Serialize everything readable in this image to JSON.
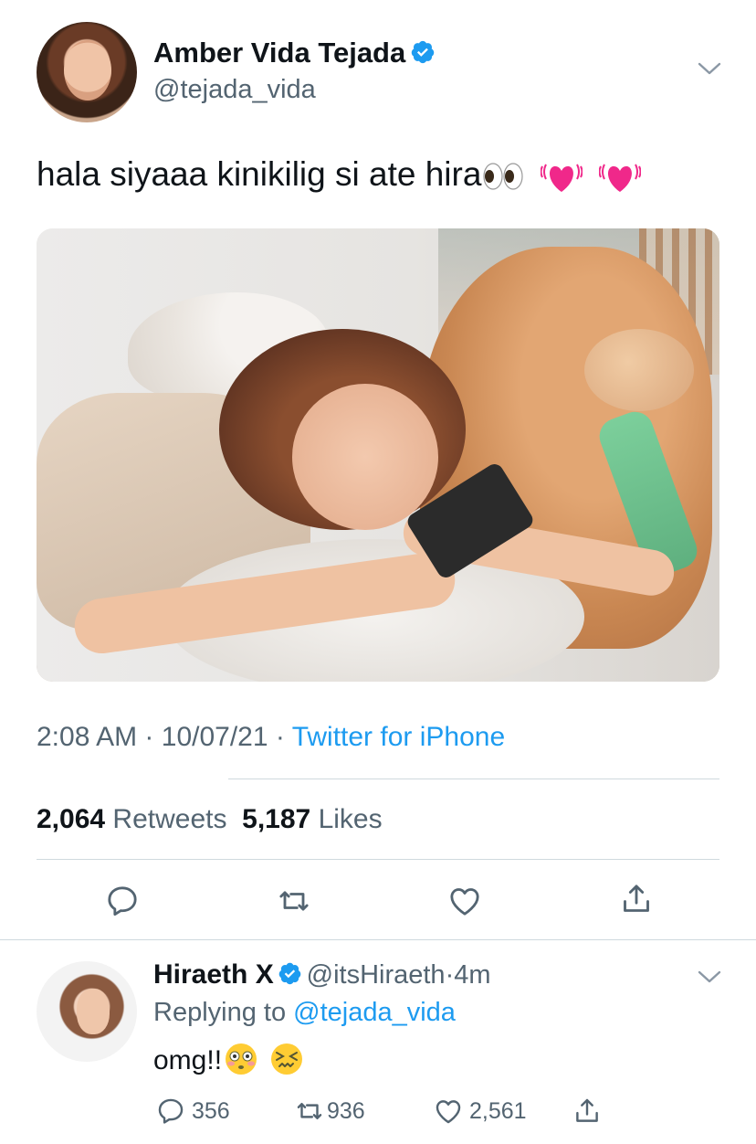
{
  "tweet": {
    "author": {
      "display_name": "Amber Vida Tejada",
      "handle": "@tejada_vida",
      "verified": true
    },
    "text": "hala siyaaa kinikilig si ate hira",
    "text_emojis": [
      "eyes",
      "growing-heart",
      "growing-heart"
    ],
    "time": "2:08 AM",
    "date": "10/07/21",
    "source": "Twitter for iPhone",
    "separator": "·",
    "stats": {
      "retweets_count": "2,064",
      "retweets_label": "Retweets",
      "likes_count": "5,187",
      "likes_label": "Likes"
    },
    "actions": [
      "reply-icon",
      "retweet-icon",
      "like-icon",
      "share-icon"
    ]
  },
  "reply": {
    "author": {
      "display_name": "Hiraeth X",
      "handle": "@itsHiraeth",
      "verified": true
    },
    "time_ago": "4m",
    "separator": "·",
    "replying_to_label": "Replying to",
    "replying_to_handle": "@tejada_vida",
    "text": "omg!!",
    "text_emojis": [
      "flushed-face",
      "confounded-face"
    ],
    "counts": {
      "replies": "356",
      "retweets": "936",
      "likes": "2,561"
    }
  },
  "colors": {
    "text": "#0f1419",
    "secondary": "#536471",
    "link": "#1d9bf0",
    "divider": "#cfd9de"
  }
}
